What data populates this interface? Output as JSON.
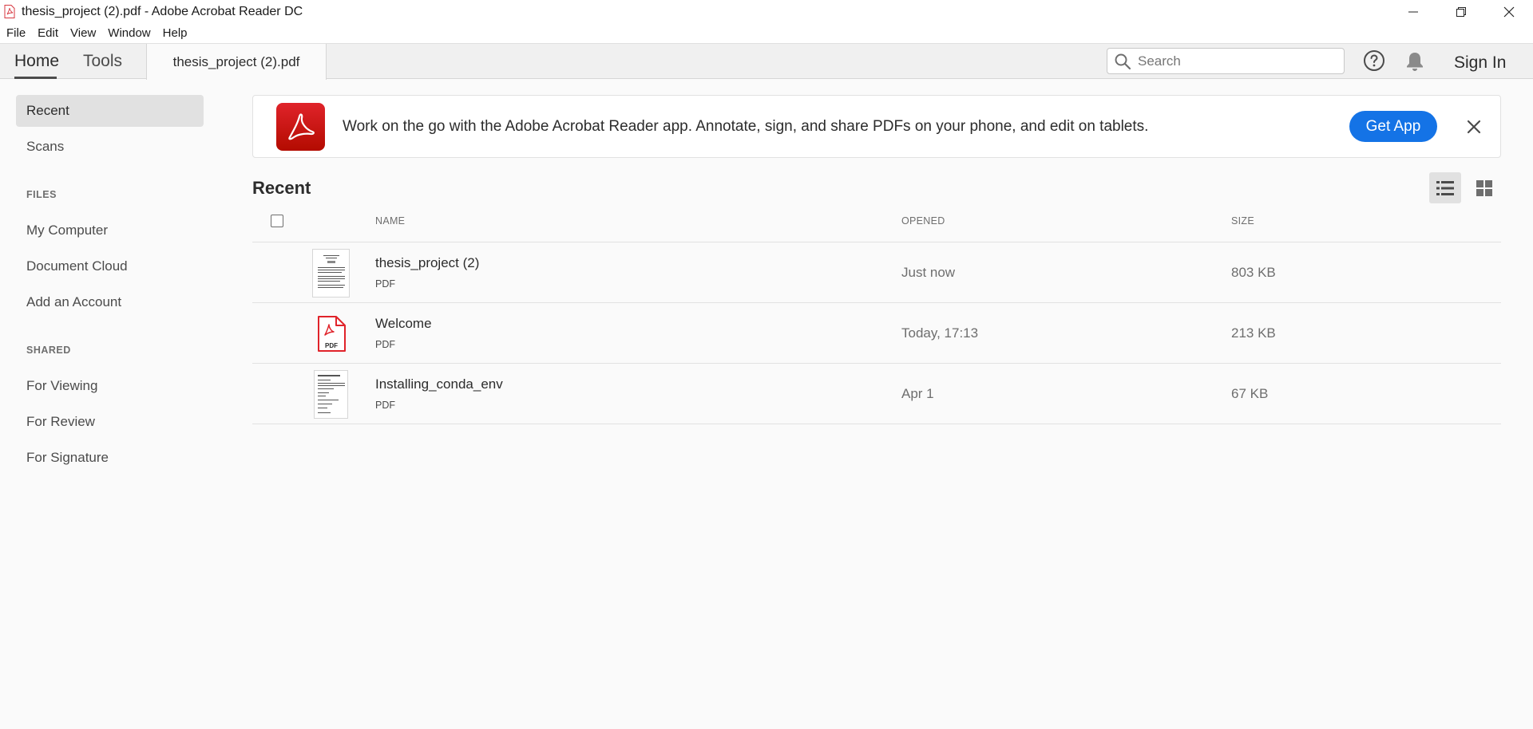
{
  "window": {
    "title": "thesis_project (2).pdf - Adobe Acrobat Reader DC"
  },
  "menu": [
    "File",
    "Edit",
    "View",
    "Window",
    "Help"
  ],
  "tabs": {
    "home": "Home",
    "tools": "Tools",
    "document": "thesis_project (2).pdf"
  },
  "search": {
    "placeholder": "Search",
    "value": ""
  },
  "header": {
    "sign_in": "Sign In"
  },
  "sidebar": {
    "top_items": [
      "Recent",
      "Scans"
    ],
    "files_heading": "FILES",
    "files_items": [
      "My Computer",
      "Document Cloud",
      "Add an Account"
    ],
    "shared_heading": "SHARED",
    "shared_items": [
      "For Viewing",
      "For Review",
      "For Signature"
    ]
  },
  "banner": {
    "message": "Work on the go with the Adobe Acrobat Reader app. Annotate, sign, and share PDFs on your phone, and edit on tablets.",
    "button": "Get App"
  },
  "recent": {
    "title": "Recent",
    "columns": {
      "name": "NAME",
      "opened": "OPENED",
      "size": "SIZE"
    },
    "files": [
      {
        "name": "thesis_project (2)",
        "type": "PDF",
        "opened": "Just now",
        "size": "803 KB",
        "thumb": "document-thumbnail"
      },
      {
        "name": "Welcome",
        "type": "PDF",
        "opened": "Today, 17:13",
        "size": "213 KB",
        "thumb": "pdf-file-icon"
      },
      {
        "name": "Installing_conda_env",
        "type": "PDF",
        "opened": "Apr 1",
        "size": "67 KB",
        "thumb": "document-thumbnail"
      }
    ]
  },
  "colors": {
    "accent": "#1473e6",
    "acrobat_red": "#e0232a"
  }
}
